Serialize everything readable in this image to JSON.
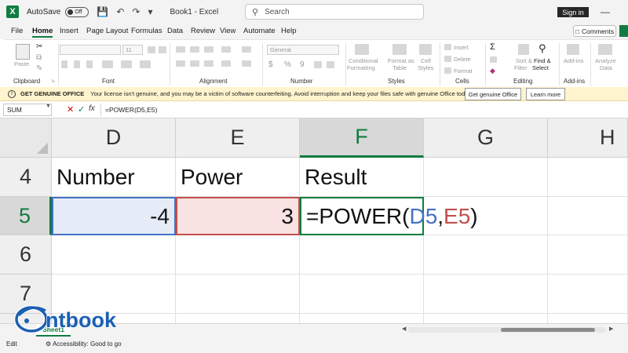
{
  "titlebar": {
    "autosave_label": "AutoSave",
    "autosave_state": "Off",
    "document_title": "Book1  -  Excel",
    "search_placeholder": "Search",
    "signin_label": "Sign in"
  },
  "menu": {
    "tabs": [
      "File",
      "Home",
      "Insert",
      "Page Layout",
      "Formulas",
      "Data",
      "Review",
      "View",
      "Automate",
      "Help"
    ],
    "active_tab": "Home",
    "comments_label": "Comments"
  },
  "ribbon": {
    "groups": [
      "Clipboard",
      "Font",
      "Alignment",
      "Number",
      "Styles",
      "Cells",
      "Editing",
      "Add-ins"
    ],
    "paste_label": "Paste",
    "font_size": "11",
    "number_format": "General",
    "conditional_formatting": [
      "Conditional",
      "Formatting"
    ],
    "format_as_table": [
      "Format as",
      "Table"
    ],
    "cell_styles": [
      "Cell",
      "Styles"
    ],
    "insert_label": "Insert",
    "delete_label": "Delete",
    "format_label": "Format",
    "sort_filter": [
      "Sort &",
      "Filter"
    ],
    "find_select": [
      "Find &",
      "Select"
    ],
    "addins_label": "Add-ins",
    "analyze_data": [
      "Analyze",
      "Data"
    ]
  },
  "license_bar": {
    "title": "GET GENUINE OFFICE",
    "message": "Your license isn't genuine, and you may be a victim of software counterfeiting. Avoid interruption and keep your files safe with genuine Office today.",
    "primary_button": "Get genuine Office",
    "secondary_button": "Learn more"
  },
  "formula_bar": {
    "name_box": "SUM",
    "formula": "=POWER(D5,E5)"
  },
  "grid": {
    "columns": [
      "D",
      "E",
      "F",
      "G",
      "H"
    ],
    "selected_column": "F",
    "rows": [
      "4",
      "5",
      "6",
      "7"
    ],
    "selected_row": "5",
    "header_row": {
      "D": "Number",
      "E": "Power",
      "F": "Result"
    },
    "data_row": {
      "D": "-4",
      "E": "3"
    },
    "editing_formula": {
      "prefix": "=POWER(",
      "ref1": "D5",
      "sep": ",",
      "ref2": "E5",
      "suffix": ")"
    }
  },
  "sheets": {
    "active": "Sheet1"
  },
  "status": {
    "mode": "Edit",
    "accessibility": "Accessibility: Good to go"
  },
  "watermark": {
    "brand": "ntbook"
  },
  "colors": {
    "excel_green": "#107c41",
    "ref_blue": "#4472c4",
    "ref_red": "#c0504d",
    "license_bg": "#fff4ce",
    "watermark_blue": "#1a5fb4"
  }
}
